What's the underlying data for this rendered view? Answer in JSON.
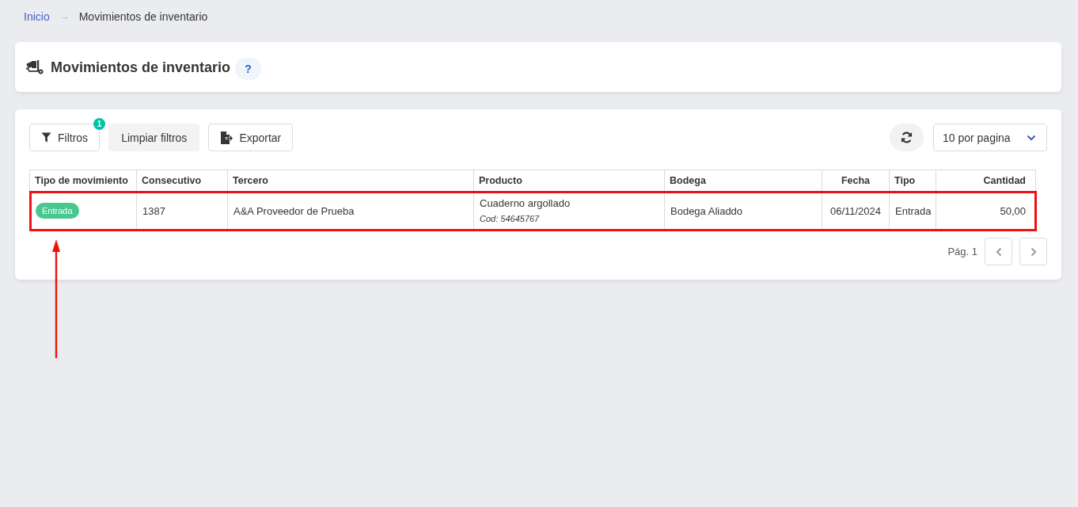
{
  "breadcrumb": {
    "items": [
      {
        "label": "Inicio",
        "kind": "link"
      },
      {
        "label": "Movimientos de inventario",
        "kind": "current"
      }
    ],
    "separator": "→"
  },
  "page_header": {
    "title": "Movimientos de inventario",
    "help": "?"
  },
  "toolbar": {
    "buttons": [
      {
        "label": "Filtros",
        "kind": "filter",
        "badge": "1"
      },
      {
        "label": "Limpiar filtros",
        "kind": "clear"
      },
      {
        "label": "Exportar",
        "kind": "export"
      }
    ],
    "page_size": "10 por pagina"
  },
  "table": {
    "columns": [
      {
        "label": "Tipo de movimiento"
      },
      {
        "label": "Consecutivo"
      },
      {
        "label": "Tercero"
      },
      {
        "label": "Producto"
      },
      {
        "label": "Bodega"
      },
      {
        "label": "Fecha"
      },
      {
        "label": "Tipo"
      },
      {
        "label": "Cantidad"
      }
    ],
    "rows": [
      {
        "highlighted": true,
        "cells": [
          {
            "kind": "tag",
            "text": "Entrada"
          },
          {
            "kind": "text",
            "text": "1387"
          },
          {
            "kind": "text",
            "text": "A&A Proveedor de Prueba"
          },
          {
            "kind": "product",
            "text": "Cuaderno argollado",
            "code": "Cod: 54645767"
          },
          {
            "kind": "text",
            "text": "Bodega Aliaddo"
          },
          {
            "kind": "text",
            "text": "06/11/2024"
          },
          {
            "kind": "text",
            "text": "Entrada"
          },
          {
            "kind": "text",
            "text": "50,00"
          }
        ]
      }
    ]
  },
  "pagination": {
    "label": "Pág. 1"
  },
  "annotations": [
    {
      "kind": "arrow"
    }
  ]
}
